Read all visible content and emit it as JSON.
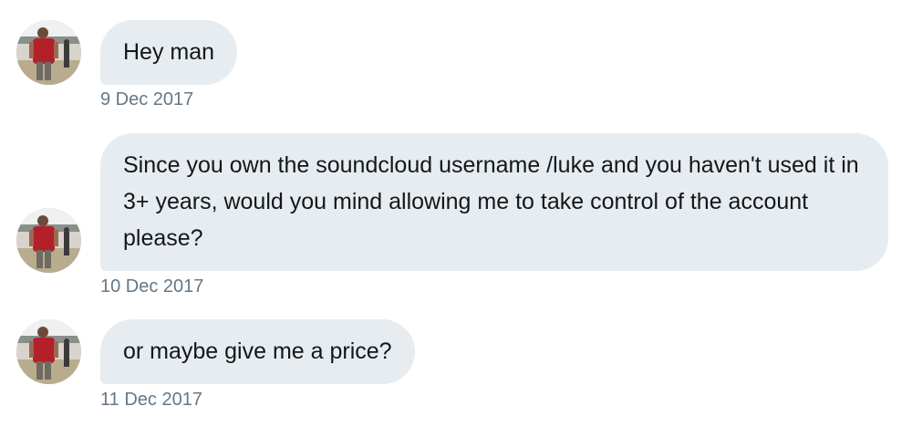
{
  "conversation": {
    "messages": [
      {
        "text": "Hey man",
        "timestamp": "9 Dec 2017"
      },
      {
        "text": "Since you own the soundcloud username /luke and you haven't used it in 3+ years, would you mind allowing me to take control of the account please?",
        "timestamp": "10 Dec 2017"
      },
      {
        "text": "or maybe give me a price?",
        "timestamp": "11 Dec 2017"
      }
    ]
  },
  "colors": {
    "bubble_background": "#e6ecf0",
    "message_text": "#14171a",
    "timestamp_text": "#657786"
  },
  "icons": {
    "avatar": "user-avatar-photo"
  }
}
